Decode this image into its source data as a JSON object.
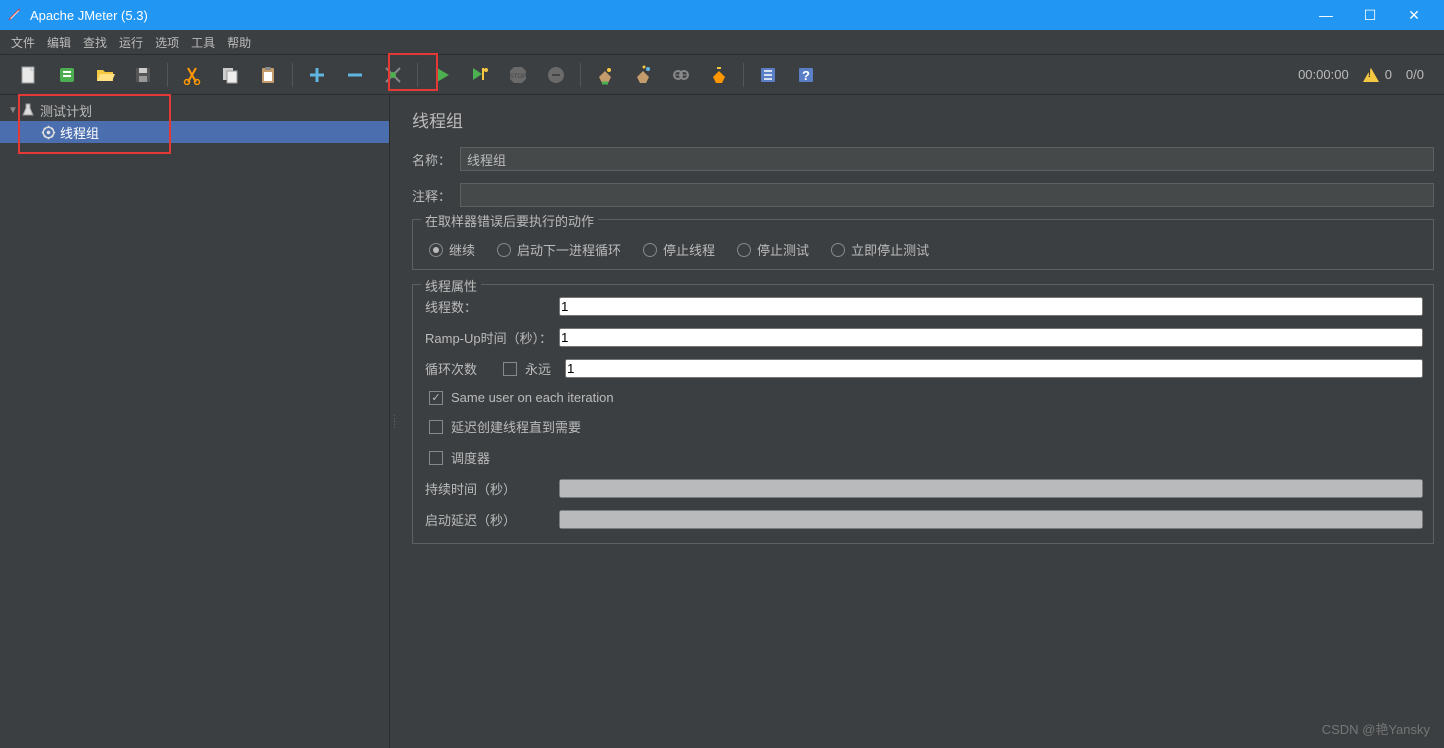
{
  "window": {
    "title": "Apache JMeter (5.3)"
  },
  "menu": {
    "items": [
      "文件",
      "编辑",
      "查找",
      "运行",
      "选项",
      "工具",
      "帮助"
    ]
  },
  "status": {
    "time": "00:00:00",
    "warnings": "0",
    "threads": "0/0"
  },
  "tree": {
    "root": {
      "label": "测试计划"
    },
    "child": {
      "label": "线程组"
    }
  },
  "panel": {
    "heading": "线程组",
    "name_label": "名称：",
    "name_value": "线程组",
    "comment_label": "注释：",
    "comment_value": "",
    "error_legend": "在取样器错误后要执行的动作",
    "radios": {
      "r1": "继续",
      "r2": "启动下一进程循环",
      "r3": "停止线程",
      "r4": "停止测试",
      "r5": "立即停止测试"
    },
    "props_legend": "线程属性",
    "threads_label": "线程数：",
    "threads_value": "1",
    "rampup_label": "Ramp-Up时间（秒）：",
    "rampup_value": "1",
    "loop_label": "循环次数",
    "loop_forever": "永远",
    "loop_value": "1",
    "cb_same_user": "Same user on each iteration",
    "cb_delay_create": "延迟创建线程直到需要",
    "cb_scheduler": "调度器",
    "duration_label": "持续时间（秒）",
    "startup_delay_label": "启动延迟（秒）"
  },
  "watermark": "CSDN @艳Yansky"
}
